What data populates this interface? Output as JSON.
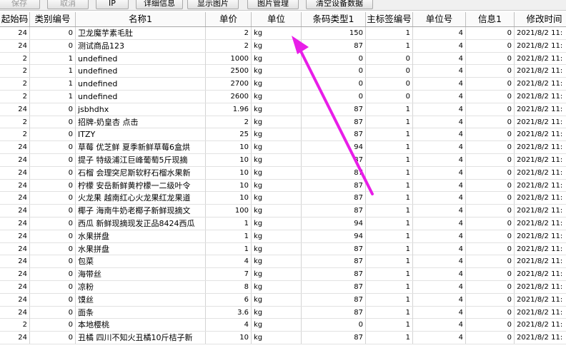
{
  "toolbar": {
    "save": "保存",
    "cancel": "取消",
    "ip": "IP",
    "detail": "详细信息",
    "show_image": "显示图片",
    "image_manage": "图片管理",
    "clear_device": "清空设备数据"
  },
  "table": {
    "headers": [
      "起始码",
      "类别编号",
      "名称1",
      "单价",
      "单位",
      "条码类型1",
      "主标签编号",
      "单位号",
      "信息1",
      "修改时间"
    ],
    "rows": [
      [
        "24",
        "0",
        "卫龙魔芋素毛肚",
        "2",
        "kg",
        "150",
        "1",
        "4",
        "0",
        "2021/8/2 11:"
      ],
      [
        "24",
        "0",
        "测试商品123",
        "2",
        "kg",
        "87",
        "1",
        "4",
        "0",
        "2021/8/2 11:"
      ],
      [
        "2",
        "1",
        "undefined",
        "1000",
        "kg",
        "0",
        "0",
        "4",
        "0",
        "2021/8/2 11:"
      ],
      [
        "2",
        "1",
        "undefined",
        "2500",
        "kg",
        "0",
        "0",
        "4",
        "0",
        "2021/8/2 11:"
      ],
      [
        "2",
        "1",
        "undefined",
        "2700",
        "kg",
        "0",
        "0",
        "4",
        "0",
        "2021/8/2 11:"
      ],
      [
        "2",
        "1",
        "undefined",
        "2600",
        "kg",
        "0",
        "0",
        "4",
        "0",
        "2021/8/2 11:"
      ],
      [
        "24",
        "0",
        "jsbhdhx",
        "1.96",
        "kg",
        "87",
        "1",
        "4",
        "0",
        "2021/8/2 11:"
      ],
      [
        "2",
        "0",
        "招牌-奶皇杏                 点击",
        "2",
        "kg",
        "87",
        "1",
        "4",
        "0",
        "2021/8/2 11:"
      ],
      [
        "2",
        "0",
        "ITZY",
        "25",
        "kg",
        "87",
        "1",
        "4",
        "0",
        "2021/8/2 11:"
      ],
      [
        "24",
        "0",
        "草莓 优芝鲜 夏季新鲜草莓6盒烘",
        "10",
        "kg",
        "94",
        "1",
        "4",
        "0",
        "2021/8/2 11:"
      ],
      [
        "24",
        "0",
        "提子 特级浦江巨峰葡萄5斤现摘",
        "10",
        "kg",
        "87",
        "1",
        "4",
        "0",
        "2021/8/2 11:"
      ],
      [
        "24",
        "0",
        "石榴 会理突尼斯软籽石榴水果新",
        "10",
        "kg",
        "87",
        "1",
        "4",
        "0",
        "2021/8/2 11:"
      ],
      [
        "24",
        "0",
        "柠檬 安岳新鲜黄柠檬一二级叶令",
        "10",
        "kg",
        "87",
        "1",
        "4",
        "0",
        "2021/8/2 11:"
      ],
      [
        "24",
        "0",
        "火龙果 越南红心火龙果红龙果道",
        "10",
        "kg",
        "87",
        "1",
        "4",
        "0",
        "2021/8/2 11:"
      ],
      [
        "24",
        "0",
        "椰子 海南牛奶老椰子新鲜现摘文",
        "100",
        "kg",
        "87",
        "1",
        "4",
        "0",
        "2021/8/2 11:"
      ],
      [
        "24",
        "0",
        "西瓜  新鲜现摘现发正品8424西瓜",
        "1",
        "kg",
        "94",
        "1",
        "4",
        "0",
        "2021/8/2 11:"
      ],
      [
        "24",
        "0",
        "水果拼盘",
        "1",
        "kg",
        "94",
        "1",
        "4",
        "0",
        "2021/8/2 11:"
      ],
      [
        "24",
        "0",
        "水果拼盘",
        "1",
        "kg",
        "87",
        "1",
        "4",
        "0",
        "2021/8/2 11:"
      ],
      [
        "24",
        "0",
        "包菜",
        "4",
        "kg",
        "87",
        "1",
        "4",
        "0",
        "2021/8/2 11:"
      ],
      [
        "24",
        "0",
        "海带丝",
        "7",
        "kg",
        "87",
        "1",
        "4",
        "0",
        "2021/8/2 11:"
      ],
      [
        "24",
        "0",
        "凉粉",
        "8",
        "kg",
        "87",
        "1",
        "4",
        "0",
        "2021/8/2 11:"
      ],
      [
        "24",
        "0",
        "馍丝",
        "6",
        "kg",
        "87",
        "1",
        "4",
        "0",
        "2021/8/2 11:"
      ],
      [
        "24",
        "0",
        "面条",
        "3.6",
        "kg",
        "87",
        "1",
        "4",
        "0",
        "2021/8/2 11:"
      ],
      [
        "2",
        "0",
        "本地樱桃",
        "4",
        "kg",
        "0",
        "1",
        "4",
        "0",
        "2021/8/2 11:"
      ],
      [
        "24",
        "0",
        "丑橘 四川不知火丑橘10斤桔子新",
        "10",
        "kg",
        "87",
        "1",
        "4",
        "0",
        "2021/8/2 11:"
      ]
    ]
  },
  "colors": {
    "arrow": "#e81ee8",
    "toolbar_bg": "#f0f0f0",
    "header_bg": "#fafafa",
    "grid_line": "#d4d4d4"
  }
}
